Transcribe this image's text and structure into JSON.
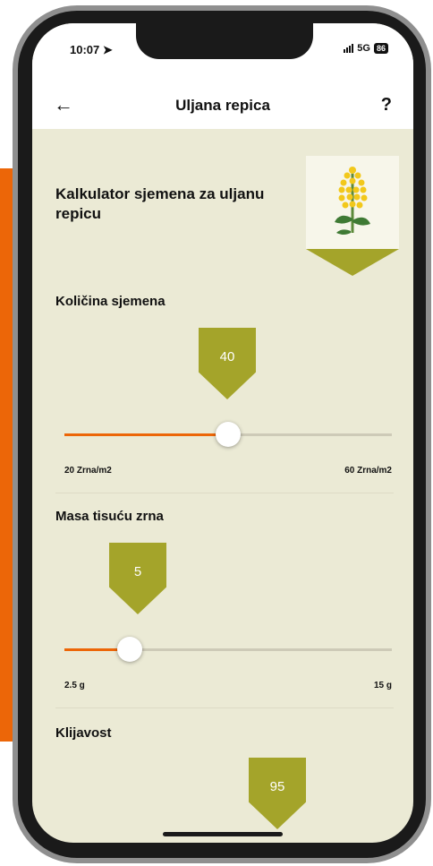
{
  "status_bar": {
    "time": "10:07",
    "network": "5G",
    "battery": "86"
  },
  "nav": {
    "back_icon": "arrow-left-icon",
    "title": "Uljana repica",
    "help": "?"
  },
  "header": {
    "title": "Kalkulator sjemena za uljanu repicu",
    "image_icon": "rapeseed-plant-icon"
  },
  "sliders": [
    {
      "label": "Količina sjemena",
      "value": "40",
      "min_label": "20 Zrna/m2",
      "max_label": "60 Zrna/m2",
      "min": 20,
      "max": 60,
      "current": 40
    },
    {
      "label": "Masa tisuću zrna",
      "value": "5",
      "min_label": "2.5 g",
      "max_label": "15 g",
      "min": 2.5,
      "max": 15,
      "current": 5
    },
    {
      "label": "Klijavost",
      "value": "95"
    }
  ],
  "colors": {
    "accent": "#ec6608",
    "marker": "#a4a42a",
    "background": "#ebead5"
  }
}
